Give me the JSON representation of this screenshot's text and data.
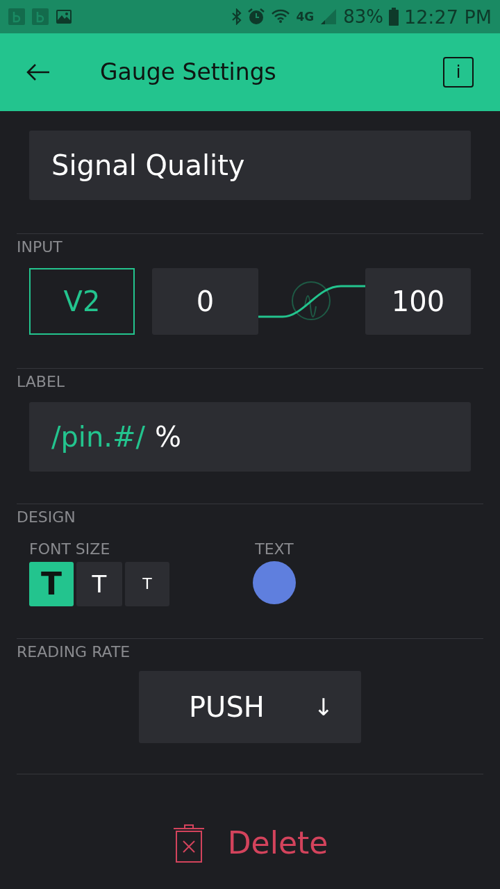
{
  "status_bar": {
    "network": "4G",
    "battery": "83%",
    "time": "12:27 PM"
  },
  "header": {
    "title": "Gauge Settings",
    "info_button": "i"
  },
  "name_field": {
    "value": "Signal Quality"
  },
  "input": {
    "heading": "INPUT",
    "pin": "V2",
    "min": "0",
    "max": "100"
  },
  "label": {
    "heading": "LABEL",
    "parts": [
      {
        "text": "/pin.#/",
        "kind": "token"
      },
      {
        "text": "%",
        "kind": "plain"
      }
    ]
  },
  "design": {
    "heading": "DESIGN",
    "font_size_label": "FONT SIZE",
    "font_sizes": [
      {
        "label": "T",
        "kind": "large",
        "selected": true
      },
      {
        "label": "T",
        "kind": "medium",
        "selected": false
      },
      {
        "label": "T",
        "kind": "small",
        "selected": false
      }
    ],
    "text_color_label": "TEXT",
    "swatch": {
      "color": "#5f7fde"
    }
  },
  "reading_rate": {
    "heading": "READING RATE",
    "value": "PUSH",
    "arrow": "↓"
  },
  "delete_button": {
    "label": "Delete"
  }
}
